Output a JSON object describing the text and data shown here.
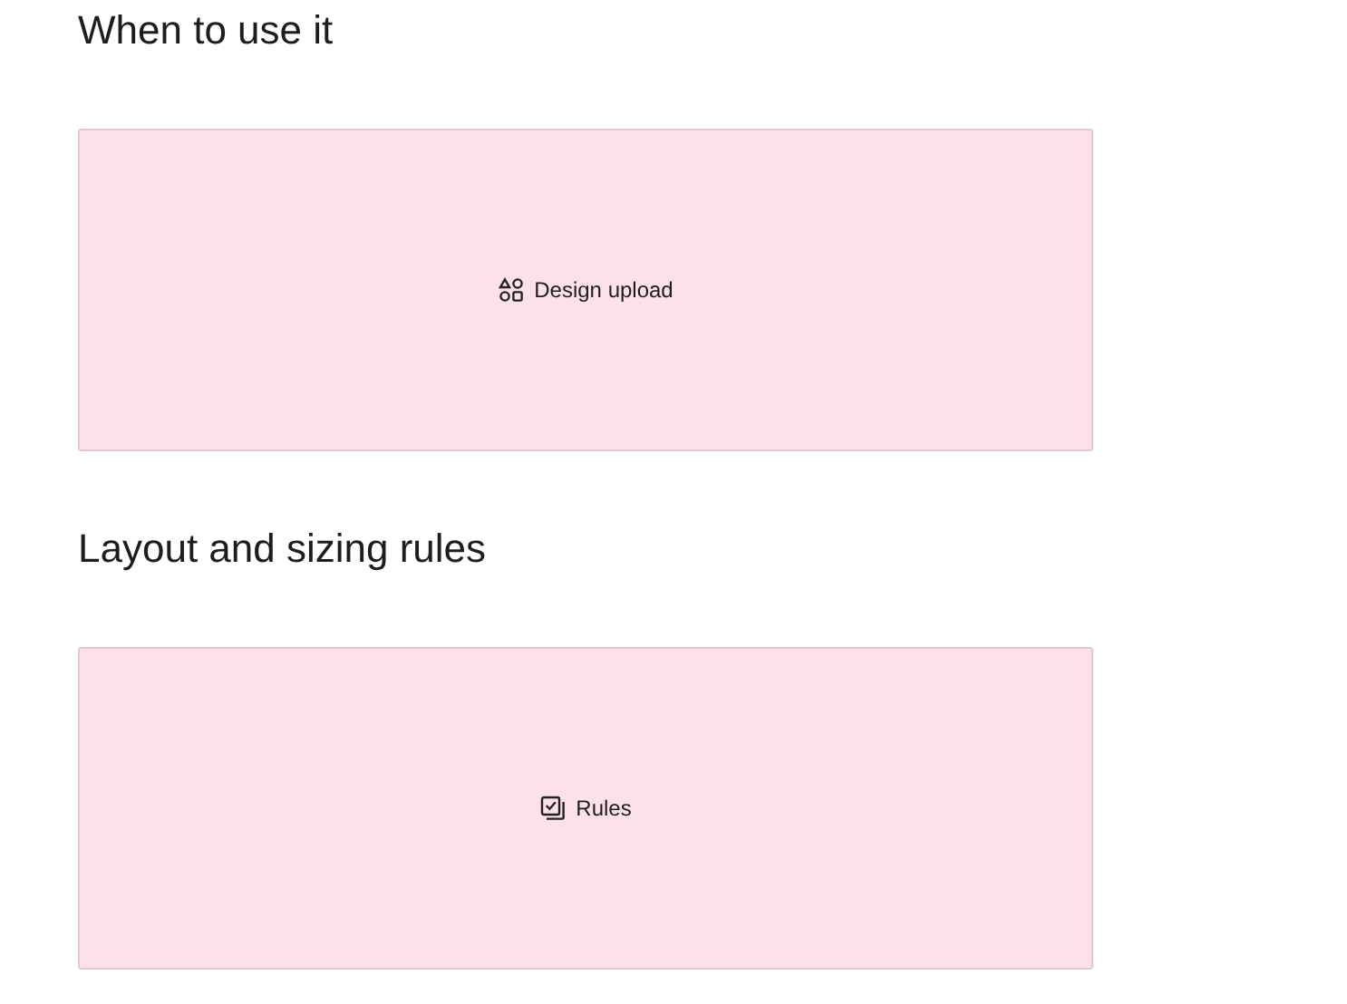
{
  "sections": [
    {
      "heading": "When to use it",
      "placeholder": {
        "label": "Design upload",
        "kind": "shapes"
      }
    },
    {
      "heading": "Layout and sizing rules",
      "placeholder": {
        "label": "Rules",
        "kind": "checklist"
      }
    }
  ]
}
